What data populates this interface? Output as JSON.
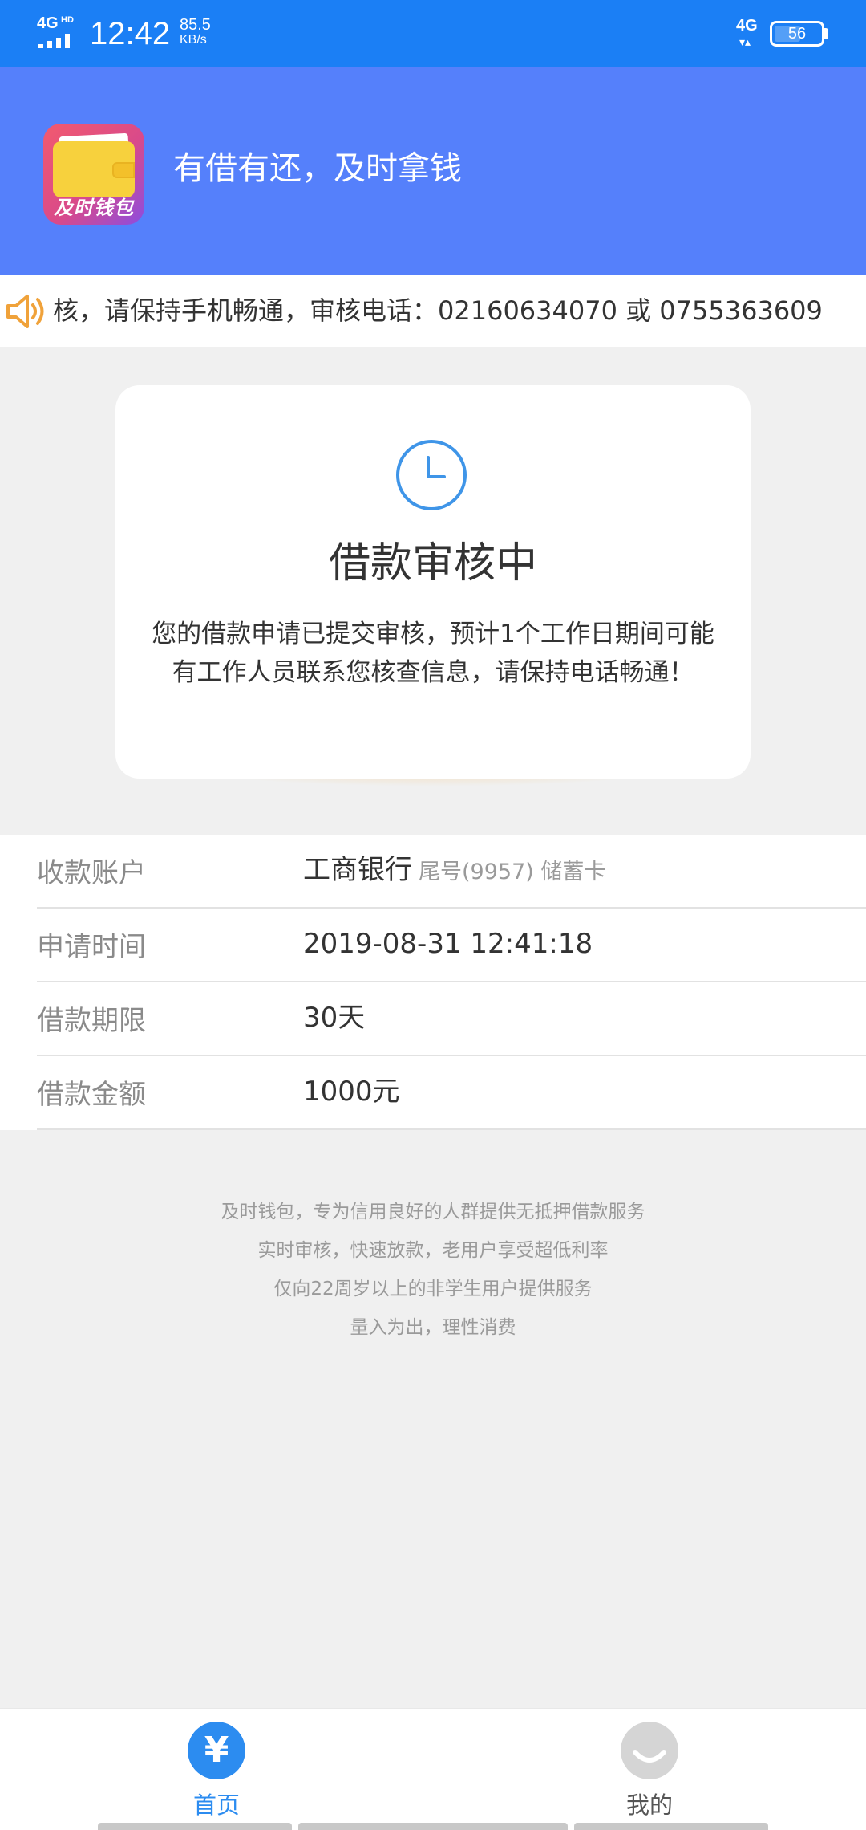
{
  "status_bar": {
    "network": "4G",
    "network_sub": "HD",
    "time": "12:42",
    "speed_value": "85.5",
    "speed_unit": "KB/s",
    "mobile_data": "4G",
    "battery": "56"
  },
  "header": {
    "app_logo_text": "及时钱包",
    "slogan": "有借有还，及时拿钱"
  },
  "notice": {
    "text": "核，请保持手机畅通，审核电话：02160634070 或 0755363609"
  },
  "status_card": {
    "title": "借款审核中",
    "description": "您的借款申请已提交审核，预计1个工作日期间可能有工作人员联系您核查信息，请保持电话畅通！"
  },
  "info": {
    "rows": [
      {
        "label": "收款账户",
        "value": "工商银行",
        "sub": "尾号(9957) 储蓄卡"
      },
      {
        "label": "申请时间",
        "value": "2019-08-31 12:41:18"
      },
      {
        "label": "借款期限",
        "value": "30天"
      },
      {
        "label": "借款金额",
        "value": "1000元"
      }
    ]
  },
  "footer": {
    "lines": [
      "及时钱包，专为信用良好的人群提供无抵押借款服务",
      "实时审核，快速放款，老用户享受超低利率",
      "仅向22周岁以上的非学生用户提供服务",
      "量入为出，理性消费"
    ]
  },
  "tabs": {
    "home_icon": "¥",
    "home_label": "首页",
    "mine_label": "我的"
  },
  "colors": {
    "status_bar": "#1b7ff5",
    "header": "#5580fb",
    "accent": "#2c8cf0",
    "speaker": "#f0a23a"
  },
  "icons": {
    "speaker": "speaker-icon",
    "clock": "clock-icon",
    "home": "yuan-icon",
    "mine": "smile-icon"
  }
}
